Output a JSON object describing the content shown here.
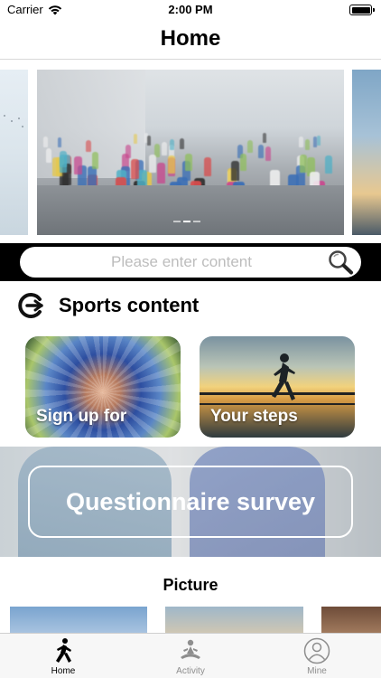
{
  "status_bar": {
    "carrier": "Carrier",
    "time": "2:00 PM"
  },
  "nav": {
    "title": "Home"
  },
  "banner": {
    "slide_count": 3,
    "active_index": 1
  },
  "search": {
    "placeholder": "Please enter content"
  },
  "sports_section": {
    "title": "Sports content",
    "cards": [
      {
        "label": "Sign up for"
      },
      {
        "label": "Your steps"
      }
    ]
  },
  "survey": {
    "button_label": "Questionnaire survey"
  },
  "picture_section": {
    "title": "Picture"
  },
  "tab_bar": {
    "items": [
      {
        "label": "Home",
        "icon": "runner-icon",
        "active": true
      },
      {
        "label": "Activity",
        "icon": "meditation-icon",
        "active": false
      },
      {
        "label": "Mine",
        "icon": "person-circle-icon",
        "active": false
      }
    ]
  },
  "colors": {
    "active_tab": "#000000",
    "inactive_tab": "#8e8e8e",
    "search_strip": "#000000",
    "placeholder": "#bdbdbd"
  }
}
